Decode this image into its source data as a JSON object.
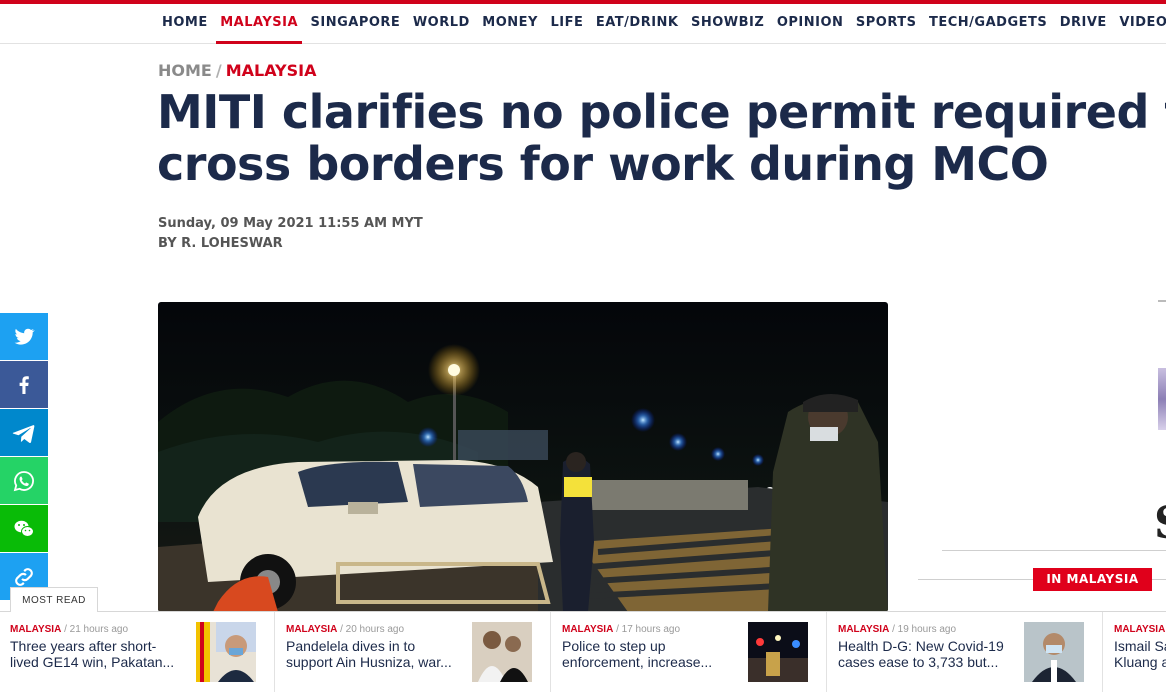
{
  "nav": {
    "items": [
      "HOME",
      "MALAYSIA",
      "SINGAPORE",
      "WORLD",
      "MONEY",
      "LIFE",
      "EAT/DRINK",
      "SHOWBIZ",
      "OPINION",
      "SPORTS",
      "TECH/GADGETS",
      "DRIVE",
      "VIDEOS"
    ],
    "active": "MALAYSIA"
  },
  "breadcrumb": {
    "home": "HOME",
    "separator": "/",
    "section": "MALAYSIA"
  },
  "article": {
    "headline_line1": "MITI clarifies no police permit required to",
    "headline_line2": "cross borders for work during MCO",
    "date": "Sunday, 09 May 2021 11:55 AM MYT",
    "byline": "BY R. LOHESWAR"
  },
  "share": [
    {
      "icon": "twitter-icon",
      "color": "#1da1f2"
    },
    {
      "icon": "facebook-icon",
      "color": "#3b5998"
    },
    {
      "icon": "telegram-icon",
      "color": "#0088cc"
    },
    {
      "icon": "whatsapp-icon",
      "color": "#25d366"
    },
    {
      "icon": "wechat-icon",
      "color": "#09bb07"
    },
    {
      "icon": "link-icon",
      "color": "#1da1f2"
    }
  ],
  "sidebar": {
    "in_malaysia_label": "IN MALAYSIA",
    "partial_letter": "S"
  },
  "most_read": {
    "tab_label": "MOST READ",
    "items": [
      {
        "category": "MALAYSIA",
        "time": "21 hours ago",
        "line1": "Three years after short-",
        "line2": "lived GE14 win, Pakatan..."
      },
      {
        "category": "MALAYSIA",
        "time": "20 hours ago",
        "line1": "Pandelela dives in to",
        "line2": "support Ain Husniza, war..."
      },
      {
        "category": "MALAYSIA",
        "time": "17 hours ago",
        "line1": "Police to step up",
        "line2": "enforcement, increase..."
      },
      {
        "category": "MALAYSIA",
        "time": "19 hours ago",
        "line1": "Health D-G: New Covid-19",
        "line2": "cases ease to 3,733 but..."
      },
      {
        "category": "MALAYSIA",
        "time": "",
        "line1": "Ismail Sa",
        "line2": "Kluang a"
      }
    ]
  },
  "colors": {
    "brand_red": "#d0021b",
    "navy": "#1c2a4a"
  }
}
